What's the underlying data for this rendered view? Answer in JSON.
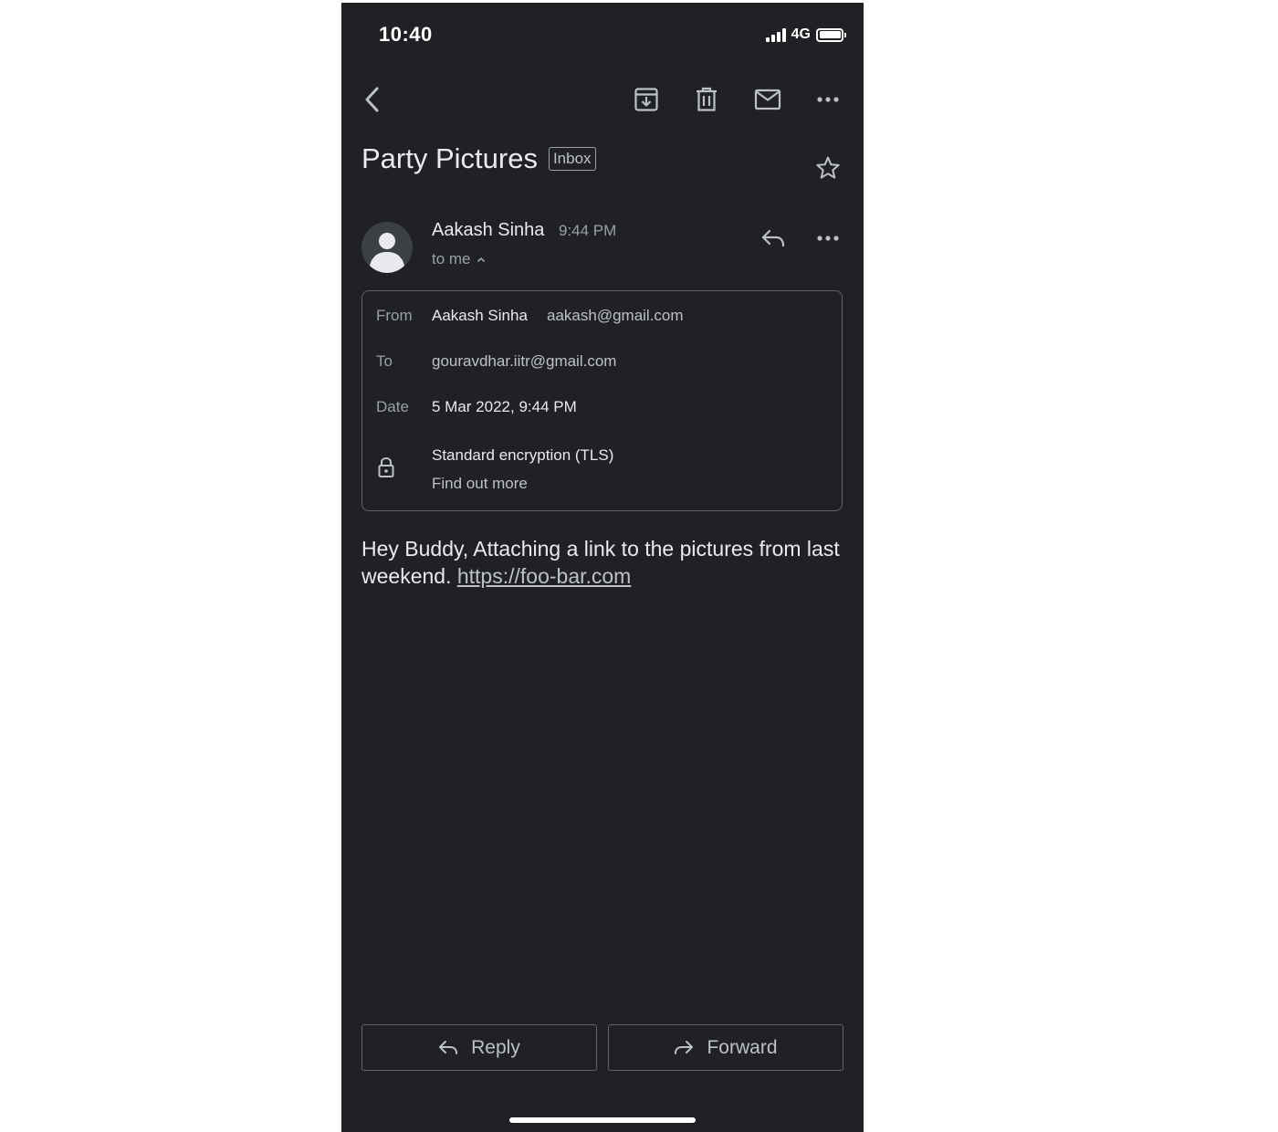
{
  "status_bar": {
    "time": "10:40",
    "network": "4G",
    "icons": [
      "signal-icon",
      "battery-icon"
    ]
  },
  "toolbar": {
    "icons": [
      "back-icon",
      "archive-icon",
      "delete-icon",
      "mark-unread-icon",
      "more-icon"
    ]
  },
  "email": {
    "subject": "Party Pictures",
    "label": "Inbox",
    "star_icon": "star-outline-icon",
    "sender": {
      "name": "Aakash Sinha",
      "time": "9:44 PM",
      "recipient_summary": "to me",
      "avatar_icon": "default-avatar-icon"
    },
    "details": {
      "from_label": "From",
      "from_name": "Aakash Sinha",
      "from_email": "aakash@gmail.com",
      "to_label": "To",
      "to_email": "gouravdhar.iitr@gmail.com",
      "date_label": "Date",
      "date_value": "5 Mar 2022, 9:44 PM",
      "encryption_text": "Standard encryption (TLS)",
      "find_out_more": "Find out more",
      "lock_icon": "lock-icon"
    },
    "body": {
      "text": "Hey Buddy, Attaching a link to the pictures from last weekend. ",
      "link": "https://foo-bar.com"
    }
  },
  "actions": {
    "reply_label": "Reply",
    "forward_label": "Forward"
  },
  "colors": {
    "background": "#202124",
    "text_primary": "#e8eaed",
    "text_secondary": "#9aa0a6",
    "border": "#5f6368"
  }
}
